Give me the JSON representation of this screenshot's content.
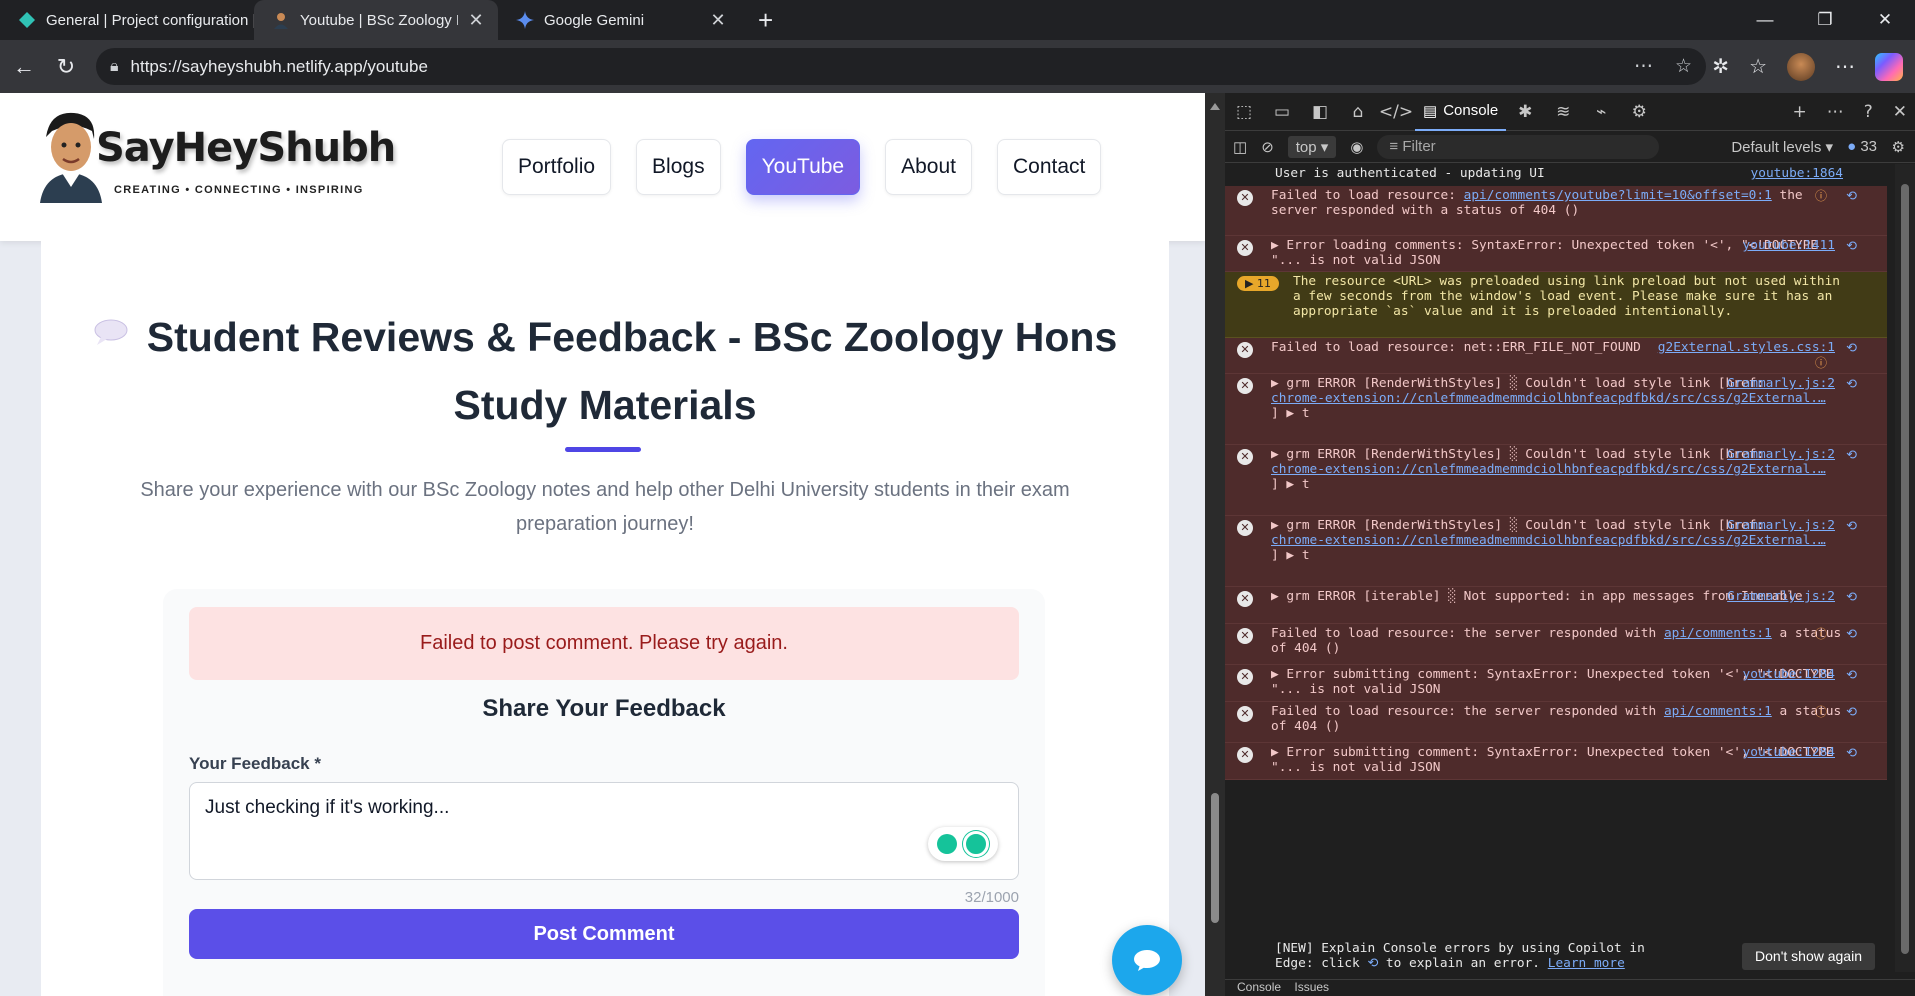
{
  "browser": {
    "tabs": [
      {
        "title": "General | Project configuration | s",
        "active": false
      },
      {
        "title": "Youtube | BSc Zoology Hons Note",
        "active": true
      },
      {
        "title": "Google Gemini",
        "active": false
      }
    ],
    "url": "https://sayheyshubh.netlify.app/youtube"
  },
  "site": {
    "brand": "SayHeyShubh",
    "tagline": "CREATING • CONNECTING • INSPIRING",
    "nav": [
      "Portfolio",
      "Blogs",
      "YouTube",
      "About",
      "Contact"
    ],
    "active_nav": "YouTube"
  },
  "section": {
    "title": "Student Reviews & Feedback - BSc Zoology Hons Study Materials",
    "subtitle": "Share your experience with our BSc Zoology notes and help other Delhi University students in their exam preparation journey!",
    "alert": "Failed to post comment. Please try again.",
    "form_title": "Share Your Feedback",
    "field_label": "Your Feedback *",
    "field_value": "Just checking if it's working...",
    "char_count": "32/1000",
    "submit": "Post Comment"
  },
  "devtools": {
    "panel": "Console",
    "context": "top",
    "filter_placeholder": "Filter",
    "levels": "Default levels",
    "issue_count": "33",
    "logs": [
      {
        "type": "plain",
        "text": "User is authenticated - updating UI",
        "source": "youtube:1864"
      },
      {
        "type": "error",
        "text": "Failed to load resource: ",
        "link": "api/comments/youtube?limit=10&offset=0:1",
        "rest": " the server responded with a status of 404 ()"
      },
      {
        "type": "error",
        "text": "▶ Error loading comments: SyntaxError: Unexpected token '<', \"<!DOCTYPE \"... is not valid JSON",
        "source": "youtube:1411"
      },
      {
        "type": "warn",
        "badge": "11",
        "text": "The resource <URL> was preloaded using link preload but not used within a few seconds from the window's load event. Please make sure it has an appropriate `as` value and it is preloaded intentionally."
      },
      {
        "type": "error",
        "text": "Failed to load resource: net::ERR_FILE_NOT_FOUND",
        "source": "g2External.styles.css:1"
      },
      {
        "type": "error",
        "text": "▶ grm ERROR [RenderWithStyles] ░ Couldn't load style link [href:",
        "link": "chrome-extension://cnlefmmeadmemmdciolhbnfeacpdfbkd/src/css/g2External.…",
        "rest": "] ▶ t",
        "source": "Grammarly.js:2"
      },
      {
        "type": "error",
        "text": "▶ grm ERROR [RenderWithStyles] ░ Couldn't load style link [href:",
        "link": "chrome-extension://cnlefmmeadmemmdciolhbnfeacpdfbkd/src/css/g2External.…",
        "rest": "] ▶ t",
        "source": "Grammarly.js:2"
      },
      {
        "type": "error",
        "text": "▶ grm ERROR [RenderWithStyles] ░ Couldn't load style link [href:",
        "link": "chrome-extension://cnlefmmeadmemmdciolhbnfeacpdfbkd/src/css/g2External.…",
        "rest": "] ▶ t",
        "source": "Grammarly.js:2"
      },
      {
        "type": "error",
        "text": "▶ grm ERROR [iterable] ░ Not supported: in app messages from Iterable",
        "source": "Grammarly.js:2"
      },
      {
        "type": "error",
        "text": "Failed to load resource: the server responded with ",
        "link": "api/comments:1",
        "rest": " a status of 404 ()"
      },
      {
        "type": "error",
        "text": "▶ Error submitting comment: SyntaxError: Unexpected token '<', \"<!DOCTYPE \"... is not valid JSON",
        "source": "youtube:1284"
      },
      {
        "type": "error",
        "text": "Failed to load resource: the server responded with ",
        "link": "api/comments:1",
        "rest": " a status of 404 ()"
      },
      {
        "type": "error",
        "text": "▶ Error submitting comment: SyntaxError: Unexpected token '<', \"<!DOCTYPE \"... is not valid JSON",
        "source": "youtube:1284"
      }
    ],
    "copilot_text_1": "[NEW] Explain Console errors by using Copilot in",
    "copilot_text_2": "Edge: click",
    "copilot_text_3": "to explain an error.",
    "learn_more": "Learn more",
    "dont_show": "Don't show again",
    "drawer_tabs": [
      "Console",
      "Issues"
    ]
  }
}
